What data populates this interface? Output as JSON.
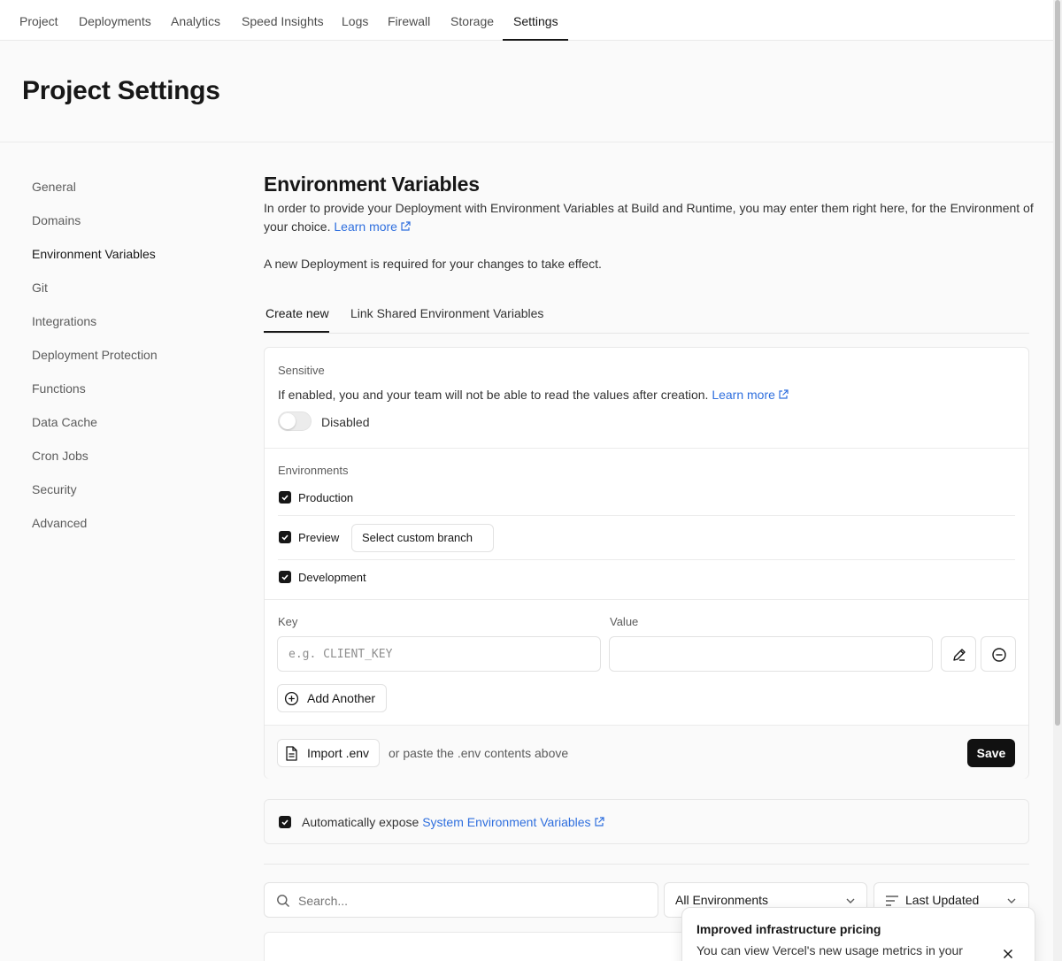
{
  "nav": {
    "tabs": [
      "Project",
      "Deployments",
      "Analytics",
      "Speed Insights",
      "Logs",
      "Firewall",
      "Storage",
      "Settings"
    ],
    "active": "Settings"
  },
  "header": {
    "title": "Project Settings"
  },
  "sidebar": {
    "items": [
      "General",
      "Domains",
      "Environment Variables",
      "Git",
      "Integrations",
      "Deployment Protection",
      "Functions",
      "Data Cache",
      "Cron Jobs",
      "Security",
      "Advanced"
    ],
    "active": "Environment Variables"
  },
  "main": {
    "title": "Environment Variables",
    "description": "In order to provide your Deployment with Environment Variables at Build and Runtime, you may enter them right here, for the Environment of your choice.",
    "learn_more": "Learn more",
    "note": "A new Deployment is required for your changes to take effect.",
    "tabs": [
      "Create new",
      "Link Shared Environment Variables"
    ]
  },
  "form": {
    "sensitive_label": "Sensitive",
    "sensitive_text": "If enabled, you and your team will not be able to read the values after creation.",
    "sensitive_learn_more": "Learn more",
    "sensitive_state": "Disabled",
    "environments_label": "Environments",
    "environments": [
      {
        "label": "Production",
        "checked": true
      },
      {
        "label": "Preview",
        "checked": true
      },
      {
        "label": "Development",
        "checked": true
      }
    ],
    "custom_branch_button": "Select custom branch",
    "key_label": "Key",
    "key_placeholder": "e.g. CLIENT_KEY",
    "key_value": "",
    "value_label": "Value",
    "value_value": "",
    "add_another": "Add Another",
    "import_button": "Import .env",
    "import_hint": "or paste the .env contents above",
    "save_button": "Save"
  },
  "system_vars": {
    "prefix": "Automatically expose",
    "link": "System Environment Variables",
    "checked": true
  },
  "filters": {
    "search_placeholder": "Search...",
    "environment_select": "All Environments",
    "sort_select": "Last Updated"
  },
  "toast": {
    "title": "Improved infrastructure pricing",
    "body": "You can view Vercel's new usage metrics in your usage dashboard."
  },
  "colors": {
    "link": "#2f6fde",
    "primary": "#111111",
    "muted": "#5c5c5c"
  }
}
